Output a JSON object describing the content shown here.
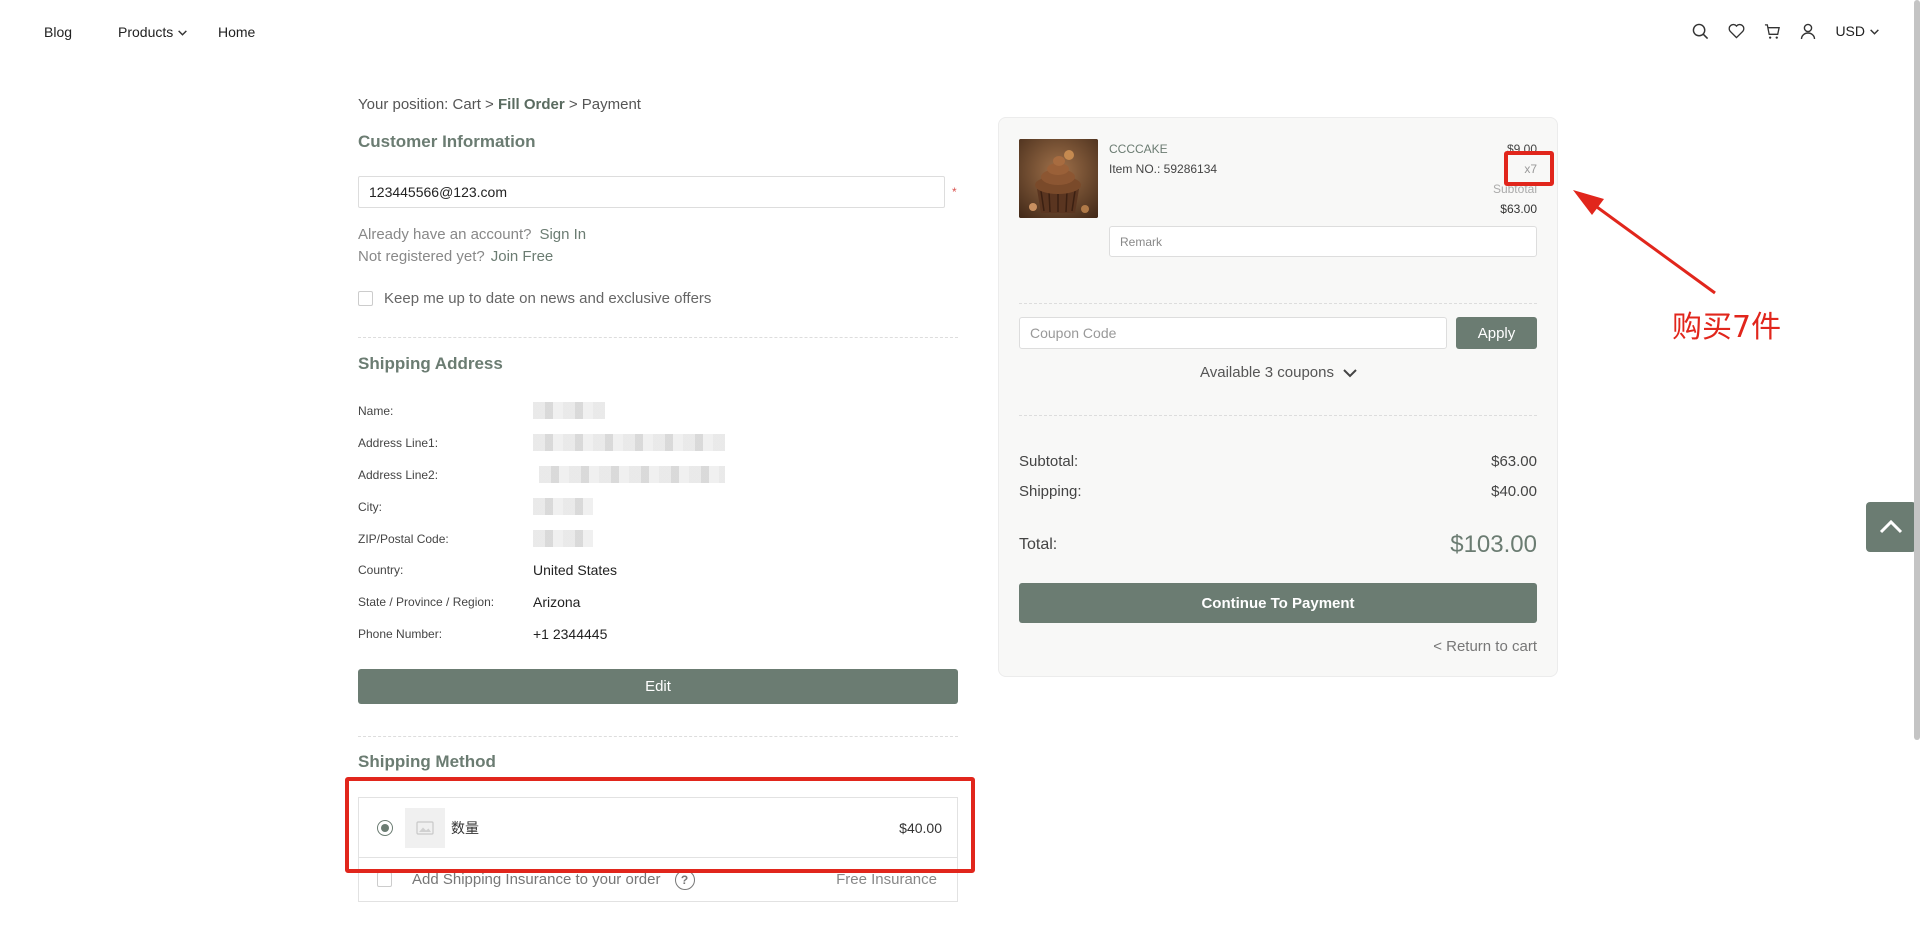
{
  "header": {
    "nav": {
      "blog": "Blog",
      "products": "Products",
      "home": "Home"
    },
    "currency": "USD",
    "icons": [
      "search-icon",
      "heart-icon",
      "cart-icon",
      "user-icon",
      "chevron-down-icon"
    ]
  },
  "breadcrumb": {
    "prefix": "Your position:",
    "cart": "Cart",
    "sep1": ">",
    "fill_order": "Fill Order",
    "sep2": ">",
    "payment": "Payment"
  },
  "customer": {
    "title": "Customer Information",
    "email": "123445566@123.com",
    "required_mark": "*",
    "have_account": "Already have an account?",
    "sign_in": "Sign In",
    "not_registered": "Not registered yet?",
    "join_free": "Join Free",
    "newsletter": "Keep me up to date on news and exclusive offers"
  },
  "shipping_address": {
    "title": "Shipping Address",
    "fields": [
      {
        "label": "Name:",
        "value": ""
      },
      {
        "label": "Address Line1:",
        "value": ""
      },
      {
        "label": "Address Line2:",
        "value": ""
      },
      {
        "label": "City:",
        "value": ""
      },
      {
        "label": "ZIP/Postal Code:",
        "value": ""
      },
      {
        "label": "Country:",
        "value": "United States"
      },
      {
        "label": "State / Province / Region:",
        "value": "Arizona"
      },
      {
        "label": "Phone Number:",
        "value": "+1 2344445"
      }
    ],
    "edit_label": "Edit"
  },
  "shipping_method": {
    "title": "Shipping Method",
    "option_name": "数量",
    "option_price": "$40.00",
    "insurance_label": "Add Shipping Insurance to your order",
    "insurance_help": "?",
    "insurance_status": "Free Insurance"
  },
  "order": {
    "product_name": "CCCCAKE",
    "item_no": "Item NO.: 59286134",
    "price": "$9.00",
    "qty": "x7",
    "subtotal_label": "Subtotal",
    "subtotal": "$63.00",
    "remark_placeholder": "Remark",
    "coupon_placeholder": "Coupon Code",
    "apply_label": "Apply",
    "coupons_available": "Available 3 coupons",
    "summary_subtotal_label": "Subtotal:",
    "summary_subtotal": "$63.00",
    "summary_shipping_label": "Shipping:",
    "summary_shipping": "$40.00",
    "total_label": "Total:",
    "total": "$103.00",
    "continue_label": "Continue To Payment",
    "return_label": "< Return to cart"
  },
  "annotation": {
    "text": "购买7件",
    "color": "#e1261c"
  },
  "colors": {
    "accent": "#6b7c72",
    "annotation": "#e1261c"
  }
}
